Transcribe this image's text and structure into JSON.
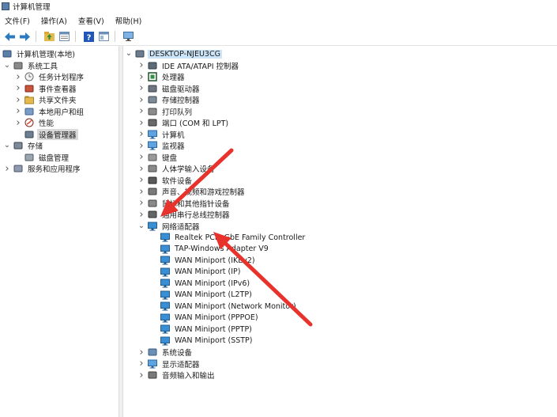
{
  "window": {
    "title": "计算机管理"
  },
  "menu": [
    "文件(F)",
    "操作(A)",
    "查看(V)",
    "帮助(H)"
  ],
  "toolbar": [
    "back-icon",
    "forward-icon",
    "folder-up-icon",
    "properties-icon",
    "help-icon",
    "view-icon",
    "monitor-icon"
  ],
  "left_tree": [
    {
      "label": "计算机管理(本地)",
      "level": 0,
      "arrow": "",
      "icon": "computer-management-icon"
    },
    {
      "label": "系统工具",
      "level": 1,
      "arrow": "v",
      "icon": "tools-icon"
    },
    {
      "label": "任务计划程序",
      "level": 2,
      "arrow": ">",
      "icon": "clock-icon"
    },
    {
      "label": "事件查看器",
      "level": 2,
      "arrow": ">",
      "icon": "event-viewer-icon"
    },
    {
      "label": "共享文件夹",
      "level": 2,
      "arrow": ">",
      "icon": "shared-folder-icon"
    },
    {
      "label": "本地用户和组",
      "level": 2,
      "arrow": ">",
      "icon": "users-icon"
    },
    {
      "label": "性能",
      "level": 2,
      "arrow": ">",
      "icon": "performance-icon"
    },
    {
      "label": "设备管理器",
      "level": 2,
      "arrow": "",
      "icon": "device-manager-icon",
      "selected": true
    },
    {
      "label": "存储",
      "level": 1,
      "arrow": "v",
      "icon": "storage-icon"
    },
    {
      "label": "磁盘管理",
      "level": 2,
      "arrow": "",
      "icon": "disk-icon"
    },
    {
      "label": "服务和应用程序",
      "level": 1,
      "arrow": ">",
      "icon": "services-icon"
    }
  ],
  "device_tree": {
    "root": "DESKTOP-NJEU3CG",
    "categories": [
      {
        "label": "IDE ATA/ATAPI 控制器",
        "icon": "ide-icon"
      },
      {
        "label": "处理器",
        "icon": "processor-icon"
      },
      {
        "label": "磁盘驱动器",
        "icon": "disk-drive-icon"
      },
      {
        "label": "存储控制器",
        "icon": "storage-controller-icon"
      },
      {
        "label": "打印队列",
        "icon": "printer-icon"
      },
      {
        "label": "端口 (COM 和 LPT)",
        "icon": "port-icon"
      },
      {
        "label": "计算机",
        "icon": "computer-icon"
      },
      {
        "label": "监视器",
        "icon": "monitor-icon"
      },
      {
        "label": "键盘",
        "icon": "keyboard-icon"
      },
      {
        "label": "人体学输入设备",
        "icon": "hid-icon"
      },
      {
        "label": "软件设备",
        "icon": "software-device-icon"
      },
      {
        "label": "声音、视频和游戏控制器",
        "icon": "sound-icon"
      },
      {
        "label": "鼠标和其他指针设备",
        "icon": "mouse-icon"
      },
      {
        "label": "通用串行总线控制器",
        "icon": "usb-icon"
      },
      {
        "label": "网络适配器",
        "icon": "network-adapter-icon",
        "expanded": true,
        "children": [
          "Realtek PCIe GbE Family Controller",
          "TAP-Windows Adapter V9",
          "WAN Miniport (IKEv2)",
          "WAN Miniport (IP)",
          "WAN Miniport (IPv6)",
          "WAN Miniport (L2TP)",
          "WAN Miniport (Network Monitor)",
          "WAN Miniport (PPPOE)",
          "WAN Miniport (PPTP)",
          "WAN Miniport (SSTP)"
        ]
      },
      {
        "label": "系统设备",
        "icon": "system-device-icon"
      },
      {
        "label": "显示适配器",
        "icon": "display-adapter-icon"
      },
      {
        "label": "音频输入和输出",
        "icon": "audio-icon"
      }
    ]
  },
  "annotation_color": "#e8322c"
}
